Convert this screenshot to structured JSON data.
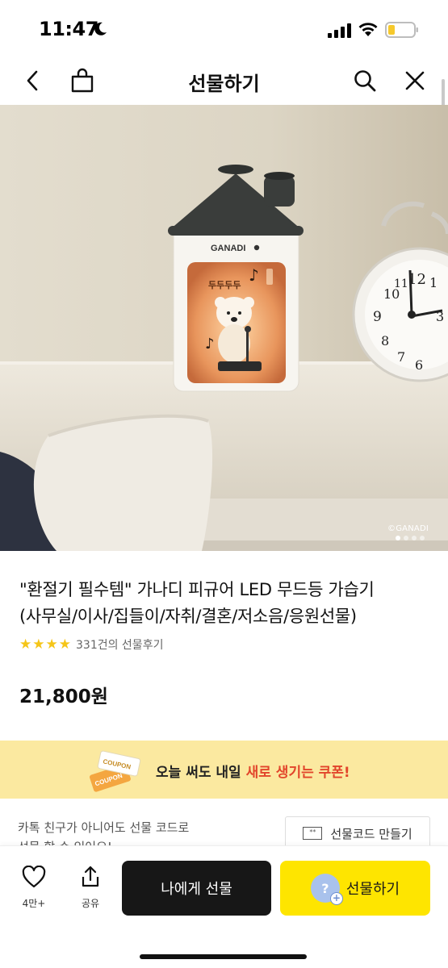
{
  "status_bar": {
    "time": "11:47"
  },
  "nav": {
    "title": "선물하기"
  },
  "hero": {
    "credit": "©GANADI",
    "slide_count": 4,
    "active_slide": 1,
    "product_logo": "GANADI",
    "figure_text": "두두두두"
  },
  "product": {
    "title_line1": "\"환절기 필수템\" 가나디 피규어 LED 무드등 가습기",
    "title_line2": "(사무실/이사/집들이/자취/결혼/저소음/응원선물)",
    "rating_stars": 4,
    "review_count_text": "331건의 선물후기",
    "price": "21,800원"
  },
  "coupon": {
    "badge_label": "COUPON",
    "text_normal": "오늘 써도 내일 ",
    "text_highlight": "새로 생기는 쿠폰!",
    "highlight_color": "#e2452b"
  },
  "gift_code": {
    "info_line1": "카톡 친구가 아니어도 선물 코드로",
    "info_line2": "선물 할 수 있어요!",
    "icon_text": "**",
    "button_label": "선물코드 만들기"
  },
  "bottom_bar": {
    "like_count": "4만+",
    "share_label": "공유",
    "self_gift_label": "나에게 선물",
    "gift_label": "선물하기",
    "gift_avatar_glyph": "?",
    "gift_plus_glyph": "+"
  },
  "colors": {
    "kakao_yellow": "#fee500",
    "dark_button": "#171717",
    "coupon_bg": "#fbe9a0",
    "star": "#f5c518"
  }
}
